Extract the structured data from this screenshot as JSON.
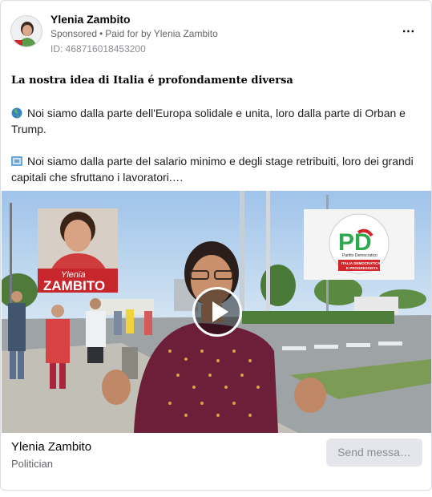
{
  "header": {
    "page_name": "Ylenia Zambito",
    "sponsored": "Sponsored",
    "separator": "•",
    "paid_for_prefix": "Paid for by",
    "paid_for_name": "Ylenia Zambito",
    "ad_id": "ID: 468716018453200",
    "more_icon": "⋯"
  },
  "body": {
    "headline": "La nostra idea di Italia é profondamente diversa",
    "paragraph1": "Noi siamo dalla parte dell'Europa solidale e unita, loro dalla parte di Orban e Trump.",
    "paragraph1_icon": "globe-europe-emoji",
    "paragraph2": "Noi siamo dalla parte del salario minimo e degli stage retribuiti, loro dei grandi capitali che sfruttano i lavoratori.…",
    "paragraph2_icon": "currency-exchange-emoji"
  },
  "media": {
    "overlay_first_name": "Ylenia",
    "overlay_last_name": "ZAMBITO",
    "logo_letters": "PD",
    "logo_caption": "Partito Democratico",
    "logo_band_line1": "ITALIA DEMOCRATICA",
    "logo_band_line2": "E PROGRESSISTA",
    "play_icon": "play-icon"
  },
  "footer": {
    "name": "Ylenia Zambito",
    "category": "Politician",
    "button_label": "Send messa…"
  },
  "colors": {
    "pd_green": "#2fa84f",
    "pd_red": "#d4252b",
    "button_bg": "#e4e6eb",
    "secondary_text": "#65676b"
  }
}
